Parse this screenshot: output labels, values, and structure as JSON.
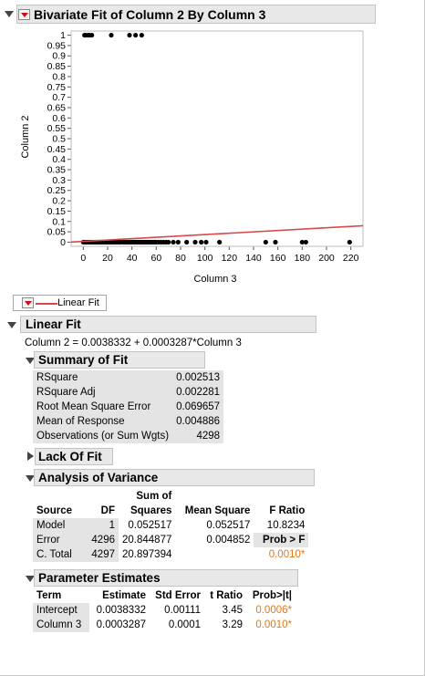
{
  "report": {
    "title": "Bivariate Fit of Column 2 By Column 3"
  },
  "legend": {
    "label": "Linear Fit"
  },
  "colors": {
    "fit_line": "#d44a4a",
    "p_value": "#e07818",
    "header_bg": "#e8e8e8",
    "label_bg": "#e4e4e4"
  },
  "chart_data": {
    "type": "scatter",
    "xlabel": "Column 3",
    "ylabel": "Column 2",
    "xlim": [
      -10,
      230
    ],
    "ylim": [
      -0.02,
      1.02
    ],
    "x_ticks": [
      0,
      20,
      40,
      60,
      80,
      100,
      120,
      140,
      160,
      180,
      200,
      220
    ],
    "y_ticks": [
      "0",
      "0.05",
      "0.1",
      "0.15",
      "0.2",
      "0.25",
      "0.3",
      "0.35",
      "0.4",
      "0.45",
      "0.5",
      "0.55",
      "0.6",
      "0.65",
      "0.7",
      "0.75",
      "0.8",
      "0.85",
      "0.9",
      "0.95",
      "1"
    ],
    "points_y1": [
      1,
      2,
      4,
      5,
      7,
      23,
      38,
      43,
      48
    ],
    "points_y0": [
      0,
      1,
      2,
      3,
      4,
      5,
      6,
      7,
      8,
      9,
      10,
      11,
      12,
      13,
      14,
      15,
      16,
      17,
      18,
      19,
      20,
      21,
      22,
      23,
      24,
      25,
      26,
      27,
      28,
      29,
      30,
      31,
      33,
      34,
      35,
      36,
      37,
      38,
      39,
      40,
      41,
      42,
      43,
      44,
      45,
      46,
      47,
      48,
      49,
      50,
      51,
      52,
      53,
      54,
      55,
      56,
      57,
      58,
      59,
      60,
      62,
      64,
      66,
      68,
      70,
      74,
      78,
      85,
      92,
      97,
      101,
      112,
      150,
      158,
      180,
      183,
      219
    ],
    "fit": {
      "intercept": 0.0038332,
      "slope": 0.0003287
    }
  },
  "linear_fit": {
    "title": "Linear Fit",
    "equation": "Column 2 = 0.0038332 + 0.0003287*Column 3"
  },
  "summary_of_fit": {
    "title": "Summary of Fit",
    "rows": [
      {
        "label": "RSquare",
        "value": "0.002513"
      },
      {
        "label": "RSquare Adj",
        "value": "0.002281"
      },
      {
        "label": "Root Mean Square Error",
        "value": "0.069657"
      },
      {
        "label": "Mean of Response",
        "value": "0.004886"
      },
      {
        "label": "Observations (or Sum Wgts)",
        "value": "4298"
      }
    ]
  },
  "lack_of_fit": {
    "title": "Lack Of Fit"
  },
  "anova": {
    "title": "Analysis of Variance",
    "header_top": [
      "",
      "",
      "Sum of",
      "",
      ""
    ],
    "headers": [
      "Source",
      "DF",
      "Squares",
      "Mean Square",
      "F Ratio"
    ],
    "rows": [
      {
        "source": "Model",
        "df": "1",
        "ss": "0.052517",
        "ms": "0.052517",
        "f": "10.8234"
      },
      {
        "source": "Error",
        "df": "4296",
        "ss": "20.844877",
        "ms": "0.004852",
        "f": "Prob > F"
      },
      {
        "source": "C. Total",
        "df": "4297",
        "ss": "20.897394",
        "ms": "",
        "f": "0.0010*"
      }
    ]
  },
  "parameter_estimates": {
    "title": "Parameter Estimates",
    "headers": [
      "Term",
      "Estimate",
      "Std Error",
      "t Ratio",
      "Prob>|t|"
    ],
    "rows": [
      {
        "term": "Intercept",
        "estimate": "0.0038332",
        "std_error": "0.00111",
        "t_ratio": "3.45",
        "prob": "0.0006*"
      },
      {
        "term": "Column 3",
        "estimate": "0.0003287",
        "std_error": "0.0001",
        "t_ratio": "3.29",
        "prob": "0.0010*"
      }
    ]
  }
}
